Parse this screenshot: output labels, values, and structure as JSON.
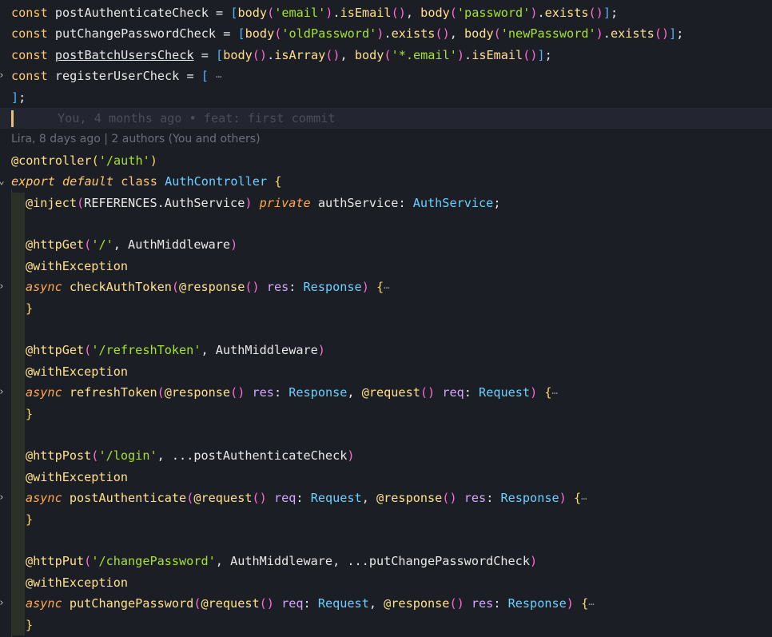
{
  "editor": {
    "blame": {
      "inline_text": "You, 4 months ago • feat: first commit",
      "codelens_text": "Lira, 8 days ago | 2 authors (You and others)"
    },
    "tokens": {
      "const": "const",
      "eq": " = ",
      "postAuthenticateCheck": "postAuthenticateCheck",
      "putChangePasswordCheck": "putChangePasswordCheck",
      "postBatchUsersCheck": "postBatchUsersCheck",
      "registerUserCheck": "registerUserCheck",
      "body": "body",
      "email_str": "'email'",
      "password_str": "'password'",
      "oldPassword_str": "'oldPassword'",
      "newPassword_str": "'newPassword'",
      "star_email_str": "'*.email'",
      "isEmail": "isEmail",
      "exists": "exists",
      "isArray": "isArray",
      "controller": "@controller",
      "auth_str": "'/auth'",
      "export": "export",
      "default": "default",
      "class": "class",
      "AuthController": "AuthController",
      "inject": "@inject",
      "REFERENCES": "REFERENCES",
      "AuthService": "AuthService",
      "private": "private",
      "authService": "authService",
      "httpGet": "@httpGet",
      "httpPost": "@httpPost",
      "httpPut": "@httpPut",
      "root_str": "'/'",
      "refresh_str": "'/refreshToken'",
      "login_str": "'/login'",
      "changePassword_str": "'/changePassword'",
      "AuthMiddleware": "AuthMiddleware",
      "withException": "@withException",
      "async": "async",
      "checkAuthToken": "checkAuthToken",
      "refreshToken": "refreshToken",
      "postAuthenticate": "postAuthenticate",
      "putChangePassword": "putChangePassword",
      "response": "@response",
      "request": "@request",
      "res": "res",
      "req": "req",
      "Response": "Response",
      "Request": "Request",
      "spread": "...",
      "ellipsis": "⋯"
    }
  }
}
